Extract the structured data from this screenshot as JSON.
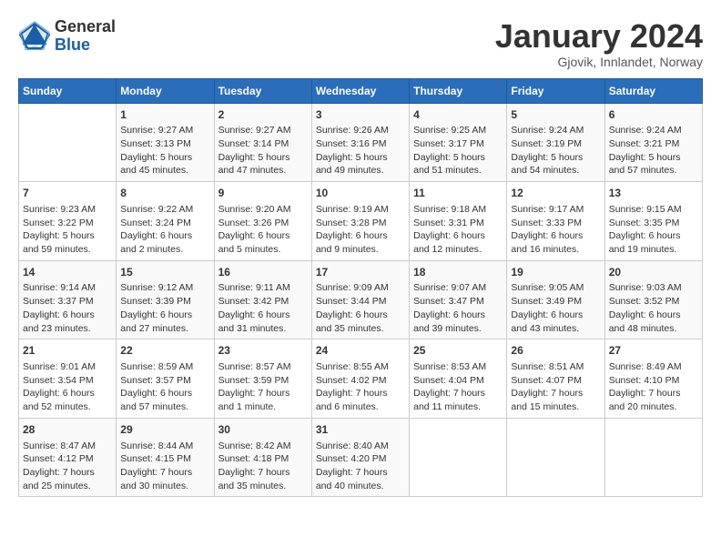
{
  "header": {
    "logo_general": "General",
    "logo_blue": "Blue",
    "month_title": "January 2024",
    "subtitle": "Gjovik, Innlandet, Norway"
  },
  "calendar": {
    "days_of_week": [
      "Sunday",
      "Monday",
      "Tuesday",
      "Wednesday",
      "Thursday",
      "Friday",
      "Saturday"
    ],
    "weeks": [
      [
        {
          "day": "",
          "content": ""
        },
        {
          "day": "1",
          "content": "Sunrise: 9:27 AM\nSunset: 3:13 PM\nDaylight: 5 hours\nand 45 minutes."
        },
        {
          "day": "2",
          "content": "Sunrise: 9:27 AM\nSunset: 3:14 PM\nDaylight: 5 hours\nand 47 minutes."
        },
        {
          "day": "3",
          "content": "Sunrise: 9:26 AM\nSunset: 3:16 PM\nDaylight: 5 hours\nand 49 minutes."
        },
        {
          "day": "4",
          "content": "Sunrise: 9:25 AM\nSunset: 3:17 PM\nDaylight: 5 hours\nand 51 minutes."
        },
        {
          "day": "5",
          "content": "Sunrise: 9:24 AM\nSunset: 3:19 PM\nDaylight: 5 hours\nand 54 minutes."
        },
        {
          "day": "6",
          "content": "Sunrise: 9:24 AM\nSunset: 3:21 PM\nDaylight: 5 hours\nand 57 minutes."
        }
      ],
      [
        {
          "day": "7",
          "content": "Sunrise: 9:23 AM\nSunset: 3:22 PM\nDaylight: 5 hours\nand 59 minutes."
        },
        {
          "day": "8",
          "content": "Sunrise: 9:22 AM\nSunset: 3:24 PM\nDaylight: 6 hours\nand 2 minutes."
        },
        {
          "day": "9",
          "content": "Sunrise: 9:20 AM\nSunset: 3:26 PM\nDaylight: 6 hours\nand 5 minutes."
        },
        {
          "day": "10",
          "content": "Sunrise: 9:19 AM\nSunset: 3:28 PM\nDaylight: 6 hours\nand 9 minutes."
        },
        {
          "day": "11",
          "content": "Sunrise: 9:18 AM\nSunset: 3:31 PM\nDaylight: 6 hours\nand 12 minutes."
        },
        {
          "day": "12",
          "content": "Sunrise: 9:17 AM\nSunset: 3:33 PM\nDaylight: 6 hours\nand 16 minutes."
        },
        {
          "day": "13",
          "content": "Sunrise: 9:15 AM\nSunset: 3:35 PM\nDaylight: 6 hours\nand 19 minutes."
        }
      ],
      [
        {
          "day": "14",
          "content": "Sunrise: 9:14 AM\nSunset: 3:37 PM\nDaylight: 6 hours\nand 23 minutes."
        },
        {
          "day": "15",
          "content": "Sunrise: 9:12 AM\nSunset: 3:39 PM\nDaylight: 6 hours\nand 27 minutes."
        },
        {
          "day": "16",
          "content": "Sunrise: 9:11 AM\nSunset: 3:42 PM\nDaylight: 6 hours\nand 31 minutes."
        },
        {
          "day": "17",
          "content": "Sunrise: 9:09 AM\nSunset: 3:44 PM\nDaylight: 6 hours\nand 35 minutes."
        },
        {
          "day": "18",
          "content": "Sunrise: 9:07 AM\nSunset: 3:47 PM\nDaylight: 6 hours\nand 39 minutes."
        },
        {
          "day": "19",
          "content": "Sunrise: 9:05 AM\nSunset: 3:49 PM\nDaylight: 6 hours\nand 43 minutes."
        },
        {
          "day": "20",
          "content": "Sunrise: 9:03 AM\nSunset: 3:52 PM\nDaylight: 6 hours\nand 48 minutes."
        }
      ],
      [
        {
          "day": "21",
          "content": "Sunrise: 9:01 AM\nSunset: 3:54 PM\nDaylight: 6 hours\nand 52 minutes."
        },
        {
          "day": "22",
          "content": "Sunrise: 8:59 AM\nSunset: 3:57 PM\nDaylight: 6 hours\nand 57 minutes."
        },
        {
          "day": "23",
          "content": "Sunrise: 8:57 AM\nSunset: 3:59 PM\nDaylight: 7 hours\nand 1 minute."
        },
        {
          "day": "24",
          "content": "Sunrise: 8:55 AM\nSunset: 4:02 PM\nDaylight: 7 hours\nand 6 minutes."
        },
        {
          "day": "25",
          "content": "Sunrise: 8:53 AM\nSunset: 4:04 PM\nDaylight: 7 hours\nand 11 minutes."
        },
        {
          "day": "26",
          "content": "Sunrise: 8:51 AM\nSunset: 4:07 PM\nDaylight: 7 hours\nand 15 minutes."
        },
        {
          "day": "27",
          "content": "Sunrise: 8:49 AM\nSunset: 4:10 PM\nDaylight: 7 hours\nand 20 minutes."
        }
      ],
      [
        {
          "day": "28",
          "content": "Sunrise: 8:47 AM\nSunset: 4:12 PM\nDaylight: 7 hours\nand 25 minutes."
        },
        {
          "day": "29",
          "content": "Sunrise: 8:44 AM\nSunset: 4:15 PM\nDaylight: 7 hours\nand 30 minutes."
        },
        {
          "day": "30",
          "content": "Sunrise: 8:42 AM\nSunset: 4:18 PM\nDaylight: 7 hours\nand 35 minutes."
        },
        {
          "day": "31",
          "content": "Sunrise: 8:40 AM\nSunset: 4:20 PM\nDaylight: 7 hours\nand 40 minutes."
        },
        {
          "day": "",
          "content": ""
        },
        {
          "day": "",
          "content": ""
        },
        {
          "day": "",
          "content": ""
        }
      ]
    ]
  }
}
